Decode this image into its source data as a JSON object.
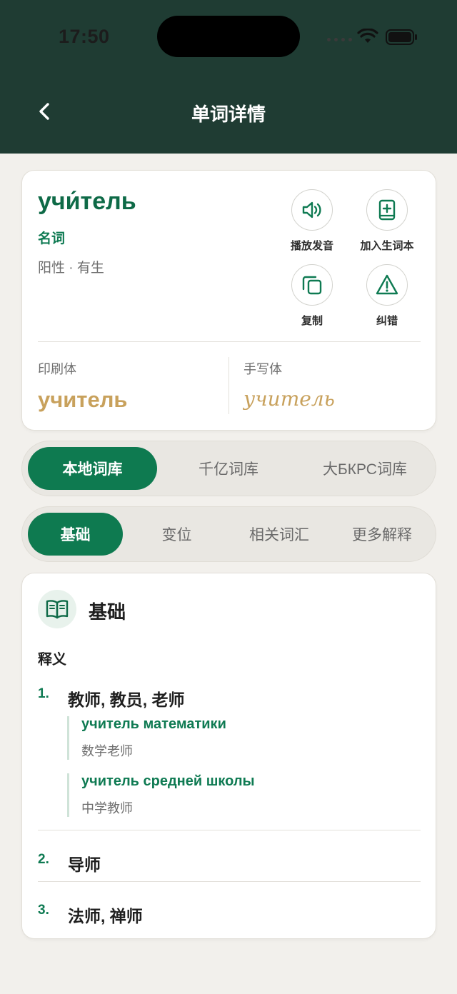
{
  "status": {
    "time": "17:50"
  },
  "nav": {
    "title": "单词详情"
  },
  "word": {
    "main": "учи́тель",
    "pos": "名词",
    "grammar": "阳性 · 有生",
    "print_label": "印刷体",
    "print_word": "учитель",
    "hand_label": "手写体",
    "hand_word": "учитель"
  },
  "actions": [
    {
      "label": "播放发音",
      "icon": "speaker-icon"
    },
    {
      "label": "加入生词本",
      "icon": "add-book-icon"
    },
    {
      "label": "复制",
      "icon": "copy-icon"
    },
    {
      "label": "纠错",
      "icon": "warning-icon"
    }
  ],
  "dictionaries": [
    "本地词库",
    "千亿词库",
    "大БКРС词库"
  ],
  "tabs": [
    "基础",
    "变位",
    "相关词汇",
    "更多解释"
  ],
  "detail": {
    "title": "基础",
    "def_label": "释义",
    "items": [
      {
        "num": "1.",
        "meaning": "教师, 教员, 老师",
        "examples": [
          {
            "ru": "учитель математики",
            "zh": "数学老师"
          },
          {
            "ru": "учитель средней школы",
            "zh": "中学教师"
          }
        ]
      },
      {
        "num": "2.",
        "meaning": "导师"
      },
      {
        "num": "3.",
        "meaning": "法师, 禅师"
      }
    ]
  },
  "colors": {
    "header": "#1f3c33",
    "accent": "#0e7a50",
    "gold": "#c8a15c"
  }
}
